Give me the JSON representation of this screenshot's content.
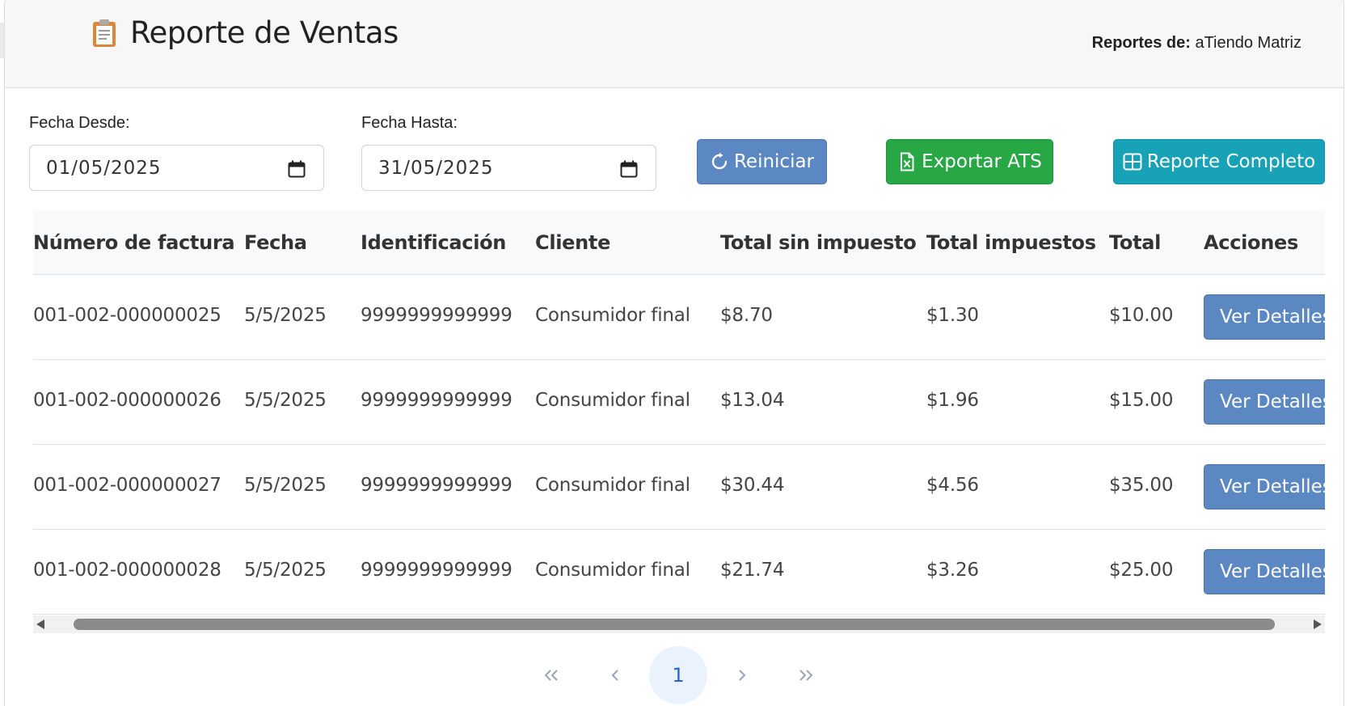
{
  "header": {
    "title": "Reporte de Ventas",
    "title_icon": "clipboard-icon",
    "reports_of_label": "Reportes de:",
    "store_name": "aTiendo Matriz"
  },
  "filters": {
    "from_label": "Fecha Desde:",
    "from_value": "01/05/2025",
    "to_label": "Fecha Hasta:",
    "to_value": "31/05/2025"
  },
  "actions": {
    "reset_label": "Reiniciar",
    "export_label": "Exportar ATS",
    "full_report_label": "Reporte Completo"
  },
  "table": {
    "columns": [
      "Número de factura",
      "Fecha",
      "Identificación",
      "Cliente",
      "Total sin impuesto",
      "Total impuestos",
      "Total",
      "Acciones"
    ],
    "rows": [
      {
        "invoice": "001-002-000000025",
        "date": "5/5/2025",
        "id": "9999999999999",
        "client": "Consumidor final",
        "subtotal": "$8.70",
        "tax": "$1.30",
        "total": "$10.00",
        "action": "Ver Detalles"
      },
      {
        "invoice": "001-002-000000026",
        "date": "5/5/2025",
        "id": "9999999999999",
        "client": "Consumidor final",
        "subtotal": "$13.04",
        "tax": "$1.96",
        "total": "$15.00",
        "action": "Ver Detalles"
      },
      {
        "invoice": "001-002-000000027",
        "date": "5/5/2025",
        "id": "9999999999999",
        "client": "Consumidor final",
        "subtotal": "$30.44",
        "tax": "$4.56",
        "total": "$35.00",
        "action": "Ver Detalles"
      },
      {
        "invoice": "001-002-000000028",
        "date": "5/5/2025",
        "id": "9999999999999",
        "client": "Consumidor final",
        "subtotal": "$21.74",
        "tax": "$3.26",
        "total": "$25.00",
        "action": "Ver Detalles"
      }
    ]
  },
  "pagination": {
    "first": "«",
    "prev": "‹",
    "current": "1",
    "next": "›",
    "last": "»"
  },
  "colors": {
    "primary": "#5b87c3",
    "success": "#28a745",
    "info": "#17a2b8"
  }
}
